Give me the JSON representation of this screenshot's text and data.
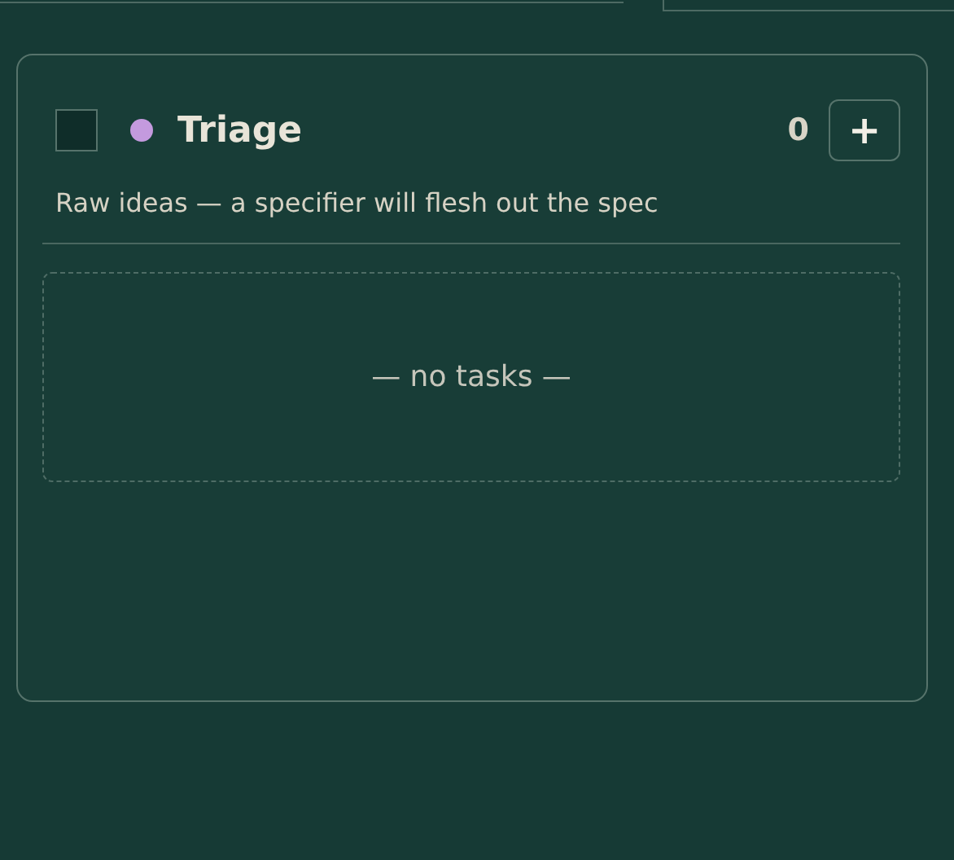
{
  "column": {
    "checked": false,
    "color": "#c49ade",
    "title": "Triage",
    "count": "0",
    "add_button": "+",
    "description": "Raw ideas — a specifier will flesh out the spec",
    "empty_text": "— no tasks —"
  }
}
